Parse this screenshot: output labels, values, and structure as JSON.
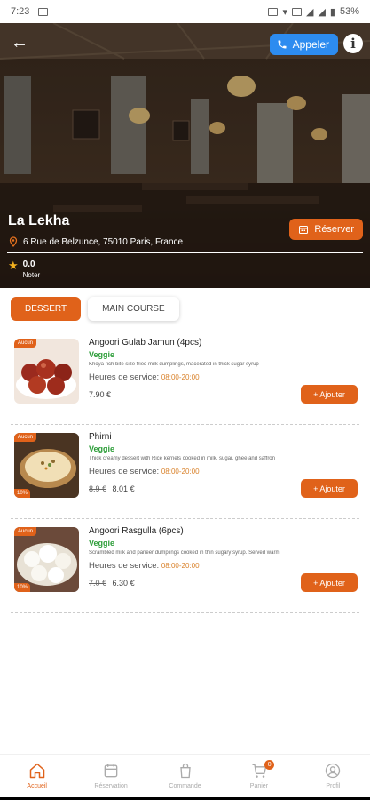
{
  "status_bar": {
    "time": "7:23",
    "battery": "53%"
  },
  "restaurant": {
    "name": "La Lekha",
    "address": "6 Rue de Belzunce, 75010 Paris, France",
    "rating": "0.0",
    "rating_label": "Noter",
    "call_label": "Appeler",
    "reserve_label": "Réserver"
  },
  "tabs": [
    {
      "label": "DESSERT",
      "active": true
    },
    {
      "label": "MAIN COURSE",
      "active": false
    }
  ],
  "items": [
    {
      "name": "Angoori Gulab Jamun (4pcs)",
      "tag": "Veggie",
      "description": "Khoya rich bite size fried milk dumplings, macerated in thick sugar syrup",
      "hours_label": "Heures de service:",
      "hours": "08:00-20:00",
      "old_price": "",
      "price": "7.90 €",
      "badge": "Aucun",
      "discount": "",
      "add_label": "+ Ajouter"
    },
    {
      "name": "Phirni",
      "tag": "Veggie",
      "description": "Thick creamy dessert with Rice kernels cooked in milk, sugar, ghee and saffron",
      "hours_label": "Heures de service:",
      "hours": "08:00-20:00",
      "old_price": "8.9 €",
      "price": "8.01 €",
      "badge": "Aucun",
      "discount": "10%",
      "add_label": "+ Ajouter"
    },
    {
      "name": "Angoori Rasgulla (6pcs)",
      "tag": "Veggie",
      "description": "Scrambled milk and paneer dumplings cooked in thin sugary syrup. Served warm",
      "hours_label": "Heures de service:",
      "hours": "08:00-20:00",
      "old_price": "7.0 €",
      "price": "6.30 €",
      "badge": "Aucun",
      "discount": "10%",
      "add_label": "+ Ajouter"
    }
  ],
  "nav": [
    {
      "label": "Accueil",
      "icon": "home-icon",
      "active": true
    },
    {
      "label": "Réservation",
      "icon": "calendar-icon",
      "active": false
    },
    {
      "label": "Commande",
      "icon": "bag-icon",
      "active": false
    },
    {
      "label": "Panier",
      "icon": "cart-icon",
      "active": false,
      "badge": "0"
    },
    {
      "label": "Profil",
      "icon": "profile-icon",
      "active": false
    }
  ],
  "colors": {
    "accent": "#e0621a",
    "call": "#2d8cf0",
    "veggie": "#2e9e3a",
    "hours": "#d9822b"
  }
}
